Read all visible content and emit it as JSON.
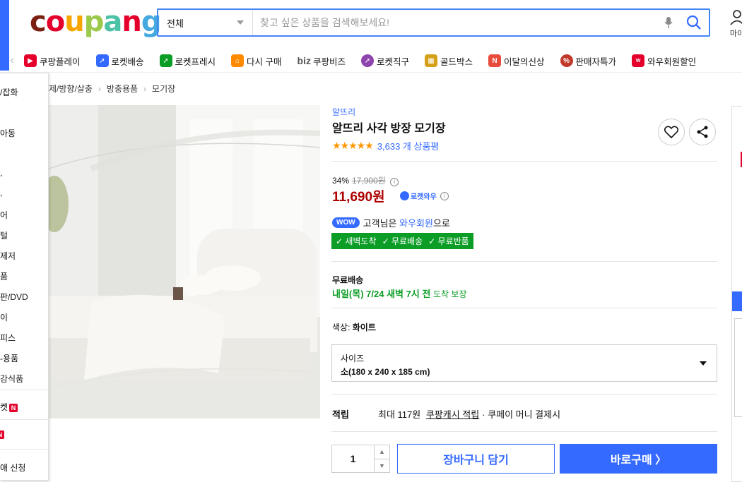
{
  "header": {
    "logo": "coupang",
    "search_category": "전체",
    "search_placeholder": "찾고 싶은 상품을 검색해보세요!",
    "mypage_label": "마이"
  },
  "nav": {
    "items": [
      {
        "label": "쿠팡플레이",
        "color": "#e4002b"
      },
      {
        "label": "로켓배송",
        "color": "#346aff"
      },
      {
        "label": "로켓프레시",
        "color": "#0c9d26"
      },
      {
        "label": "다시 구매",
        "color": "#ff8a00"
      },
      {
        "label": "쿠팡비즈",
        "prefix": "biz",
        "color": "#555"
      },
      {
        "label": "로켓직구",
        "color": "#8e44ad"
      },
      {
        "label": "골드박스",
        "color": "#d4a017"
      },
      {
        "label": "이달의신상",
        "color": "#e74c3c"
      },
      {
        "label": "판매자특가",
        "color": "#c0392b"
      },
      {
        "label": "와우회원할인",
        "color": "#e4002b"
      }
    ]
  },
  "side_menu": {
    "items": [
      "/잡화",
      "아동",
      "",
      "",
      "어",
      "털",
      "제저",
      "품",
      "판/DVD",
      "이",
      "피스",
      "-용품",
      "강식품",
      "켓",
      "",
      "애 신청"
    ]
  },
  "breadcrumb": [
    "제/방향/살충",
    "방충용품",
    "모기장"
  ],
  "product": {
    "brand": "알뜨리",
    "title": "알뜨리 사각 방장 모기장",
    "stars": "★★★★★",
    "review_count": "3,633 개 상품평",
    "discount_rate": "34%",
    "original_price": "17,900원",
    "price": "11,690원",
    "rocket_wow": "로켓와우",
    "wow_badge": "WOW",
    "wow_text_1": "고객님은",
    "wow_text_link": "와우회원",
    "wow_text_2": "으로",
    "benefits": [
      "✓ 새벽도착",
      "✓ 무료배송",
      "✓ 무료반품"
    ],
    "shipping_label": "무료배송",
    "arrival": "내일(목) 7/24 새벽 7시 전",
    "arrival_suffix": "도착 보장",
    "color_label": "색상:",
    "color_value": "화이트",
    "size_label": "사이즈",
    "size_value": "소(180 x 240 x 185 cm)",
    "points_label": "적립",
    "points_text_1": "최대 117원",
    "points_link": "쿠팡캐시 적립",
    "points_text_2": "· 쿠페이 머니 결제시",
    "quantity": "1",
    "cart_button": "장바구니 담기",
    "buy_button": "바로구매 〉"
  },
  "colors": {
    "accent": "#346aff",
    "price": "#ae0000",
    "green": "#0c9d26"
  }
}
